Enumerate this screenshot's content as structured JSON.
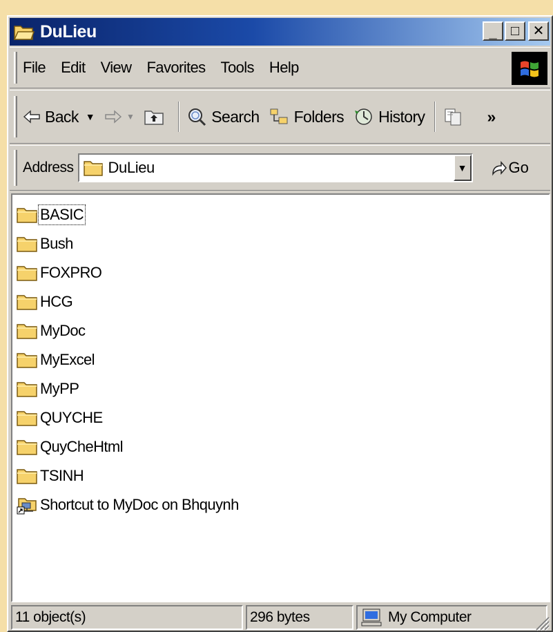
{
  "window": {
    "title": "DuLieu",
    "minimize_label": "_",
    "maximize_label": "□",
    "close_label": "✕"
  },
  "menu": [
    "File",
    "Edit",
    "View",
    "Favorites",
    "Tools",
    "Help"
  ],
  "toolbar": {
    "back_label": "Back",
    "search_label": "Search",
    "folders_label": "Folders",
    "history_label": "History",
    "more_label": "»"
  },
  "address": {
    "label": "Address",
    "value": "DuLieu",
    "go_label": "Go"
  },
  "files": [
    {
      "name": "BASIC",
      "type": "folder",
      "focused": true
    },
    {
      "name": "Bush",
      "type": "folder"
    },
    {
      "name": "FOXPRO",
      "type": "folder"
    },
    {
      "name": "HCG",
      "type": "folder"
    },
    {
      "name": "MyDoc",
      "type": "folder"
    },
    {
      "name": "MyExcel",
      "type": "folder"
    },
    {
      "name": "MyPP",
      "type": "folder"
    },
    {
      "name": "QUYCHE",
      "type": "folder"
    },
    {
      "name": "QuyCheHtml",
      "type": "folder"
    },
    {
      "name": "TSINH",
      "type": "folder"
    },
    {
      "name": "Shortcut to MyDoc on Bhquynh",
      "type": "shortcut"
    }
  ],
  "status": {
    "objects": "11 object(s)",
    "size": "296 bytes",
    "zone": "My Computer"
  },
  "colors": {
    "desktop": "#f5dfa8",
    "title_start": "#0a246a",
    "title_end": "#a6caf0",
    "folder": "#f6d26b"
  }
}
